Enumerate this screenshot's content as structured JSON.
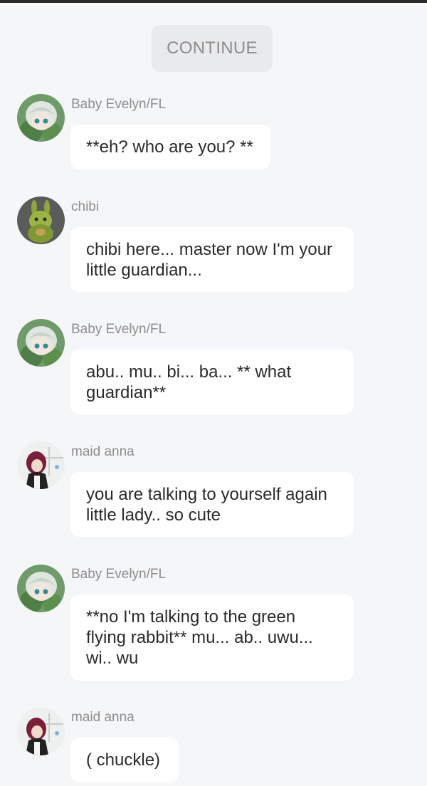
{
  "continue_button": {
    "label": "CONTINUE"
  },
  "messages": [
    {
      "sender": "Baby Evelyn/FL",
      "avatar_icon": "girl-green-avatar-icon",
      "text": "**eh? who are you? **"
    },
    {
      "sender": "chibi",
      "avatar_icon": "green-rabbit-avatar-icon",
      "text": "chibi here... master now I'm your\nlittle guardian..."
    },
    {
      "sender": "Baby Evelyn/FL",
      "avatar_icon": "girl-green-avatar-icon",
      "text": "abu.. mu.. bi... ba... ** what\nguardian**"
    },
    {
      "sender": "maid anna",
      "avatar_icon": "maid-avatar-icon",
      "text": "you are talking to yourself again\nlittle lady.. so cute"
    },
    {
      "sender": "Baby Evelyn/FL",
      "avatar_icon": "girl-green-avatar-icon",
      "text": "**no I'm talking to the green\nflying rabbit** mu... ab.. uwu...\nwi.. wu"
    },
    {
      "sender": "maid anna",
      "avatar_icon": "maid-avatar-icon",
      "text": "( chuckle)"
    }
  ]
}
